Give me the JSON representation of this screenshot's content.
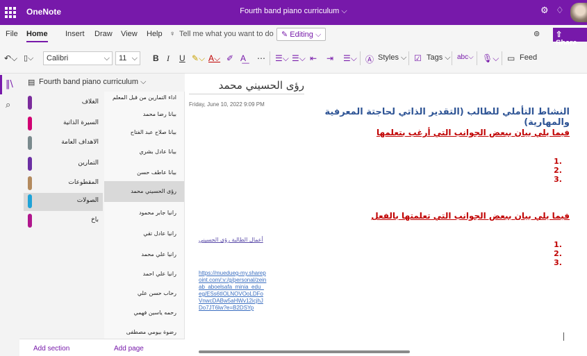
{
  "titlebar": {
    "app_name": "OneNote",
    "document_title": "Fourth band piano curriculum ⌵",
    "icons": [
      "waffle-icon",
      "settings-icon",
      "lightbulb-icon",
      "avatar"
    ]
  },
  "menu": {
    "tabs": [
      "File",
      "Home",
      "Insert",
      "Draw",
      "View",
      "Help"
    ],
    "active_tab": "Home",
    "tell_me": "Tell me what you want to do",
    "editing_label": "Editing ⌵",
    "share_label": "Share ⌵"
  },
  "ribbon": {
    "font_name": "Calibri",
    "font_size": "11",
    "styles_label": "Styles ⌵",
    "tags_label": "Tags ⌵",
    "feed_label": "Feed"
  },
  "notebook": {
    "name": "Fourth band piano curriculum ⌵"
  },
  "sections": [
    {
      "label": "الغلاف",
      "color": "#7b2c9c"
    },
    {
      "label": "السيرة الذاتية",
      "color": "#d10072"
    },
    {
      "label": "الاهداف العامة",
      "color": "#7a8a8d"
    },
    {
      "label": "التمارين",
      "color": "#6b2fa3"
    },
    {
      "label": "المقطوعات",
      "color": "#b38a5e"
    },
    {
      "label": "الصولات",
      "color": "#1fa3d7"
    },
    {
      "label": "باخ",
      "color": "#b0168d"
    }
  ],
  "selected_section": "الصولات",
  "add_section": "Add section",
  "pages": [
    "اداء التمارين من قبل المعلم",
    "بيانا رضا محمد",
    "بيانا صلاح عبد الفتاح",
    "بيانا عادل بشري",
    "بيانا عاطف حسن",
    "رؤى الحسيني محمد",
    "رانيا جابر محمود",
    "رانيا عادل تقي",
    "رانيا علي محمد",
    "رانيا علي احمد",
    "رحاب حسن علي",
    "رحمه ياسين فهمي",
    "رضوة بيومي مصطفى"
  ],
  "selected_page": "رؤى الحسيني محمد",
  "add_page": "Add page",
  "page": {
    "title": "رؤى الحسيني محمد",
    "date": "Friday, June 10, 2022   9:09 PM",
    "heading": "النشاط التأملي للطالب (التقدير الذاتي لحاجتة المعرفية والمهارية)",
    "subheading1": "فيما يلي بيان ببعض الجوانب التي أرغب بتعلمها",
    "list1": [
      "1.",
      "2.",
      "3."
    ],
    "subheading2": "فيما يلي بيان ببعض الجوانب التي تعلمتها بالفعل",
    "list2": [
      "1.",
      "2.",
      "3."
    ],
    "link_text": "أعمال الطالبة رؤى الحسيني",
    "url": "https://muedueg-my.sharepoint.com/:v:/g/personal/zeinab_aboelsafa_minia_edu_eg/ESs6tIOLNOVOoLDFoVnwcDABw5aHWv12icjhJDo7JT6lw?e=B2DSYp"
  }
}
